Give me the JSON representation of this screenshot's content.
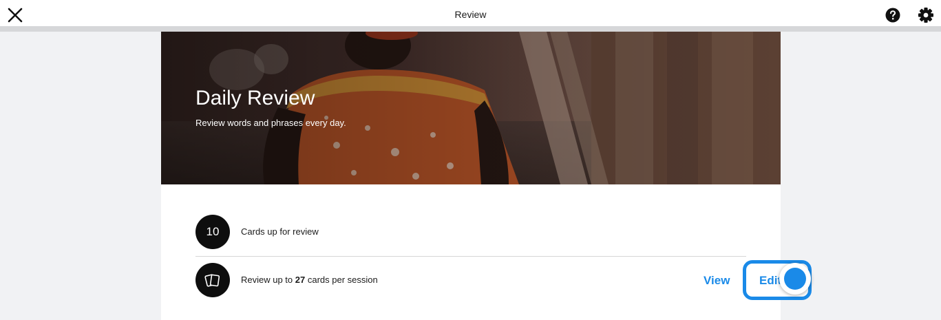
{
  "header": {
    "title": "Review",
    "close_icon": "close-icon",
    "help_icon": "help-icon",
    "settings_icon": "gear-icon"
  },
  "hero": {
    "title": "Daily Review",
    "subtitle": "Review words and phrases every day."
  },
  "stats": {
    "cards_due_count": "10",
    "cards_due_label": "Cards up for review",
    "session_prefix": "Review up to ",
    "session_count": "27",
    "session_suffix": " cards per session",
    "cards_icon": "cards-icon"
  },
  "actions": {
    "view_label": "View",
    "edit_label": "Edit"
  },
  "colors": {
    "accent": "#1a8ae8",
    "circle": "#0e0e0e"
  }
}
